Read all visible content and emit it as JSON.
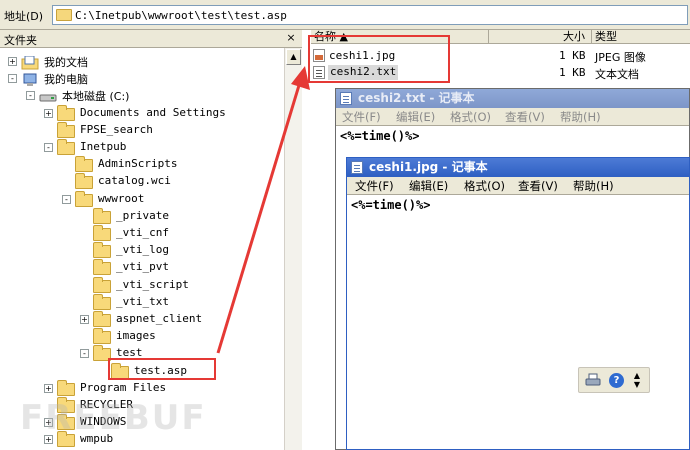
{
  "address_bar": {
    "label": "地址(D)",
    "path": "C:\\Inetpub\\wwwroot\\test\\test.asp"
  },
  "folders_pane": {
    "title": "文件夹",
    "close_glyph": "×",
    "tree": [
      {
        "label": "我的文档",
        "depth": 0,
        "toggle": "+",
        "icon": "my-documents-icon"
      },
      {
        "label": "我的电脑",
        "depth": 0,
        "toggle": "-",
        "icon": "my-computer-icon"
      },
      {
        "label": "本地磁盘 (C:)",
        "depth": 1,
        "toggle": "-",
        "icon": "local-disk-icon"
      },
      {
        "label": "Documents and Settings",
        "depth": 2,
        "toggle": "+",
        "icon": "folder-icon"
      },
      {
        "label": "FPSE_search",
        "depth": 2,
        "toggle": "",
        "icon": "folder-icon"
      },
      {
        "label": "Inetpub",
        "depth": 2,
        "toggle": "-",
        "icon": "folder-icon"
      },
      {
        "label": "AdminScripts",
        "depth": 3,
        "toggle": "",
        "icon": "folder-icon"
      },
      {
        "label": "catalog.wci",
        "depth": 3,
        "toggle": "",
        "icon": "folder-icon"
      },
      {
        "label": "wwwroot",
        "depth": 3,
        "toggle": "-",
        "icon": "folder-open-icon"
      },
      {
        "label": "_private",
        "depth": 4,
        "toggle": "",
        "icon": "folder-icon"
      },
      {
        "label": "_vti_cnf",
        "depth": 4,
        "toggle": "",
        "icon": "folder-icon"
      },
      {
        "label": "_vti_log",
        "depth": 4,
        "toggle": "",
        "icon": "folder-icon"
      },
      {
        "label": "_vti_pvt",
        "depth": 4,
        "toggle": "",
        "icon": "folder-icon"
      },
      {
        "label": "_vti_script",
        "depth": 4,
        "toggle": "",
        "icon": "folder-icon"
      },
      {
        "label": "_vti_txt",
        "depth": 4,
        "toggle": "",
        "icon": "folder-icon"
      },
      {
        "label": "aspnet_client",
        "depth": 4,
        "toggle": "+",
        "icon": "folder-icon"
      },
      {
        "label": "images",
        "depth": 4,
        "toggle": "",
        "icon": "folder-icon"
      },
      {
        "label": "test",
        "depth": 4,
        "toggle": "-",
        "icon": "folder-open-icon"
      },
      {
        "label": "test.asp",
        "depth": 5,
        "toggle": "",
        "icon": "folder-icon"
      },
      {
        "label": "Program Files",
        "depth": 2,
        "toggle": "+",
        "icon": "folder-icon"
      },
      {
        "label": "RECYCLER",
        "depth": 2,
        "toggle": "",
        "icon": "folder-icon"
      },
      {
        "label": "WINDOWS",
        "depth": 2,
        "toggle": "+",
        "icon": "folder-icon"
      },
      {
        "label": "wmpub",
        "depth": 2,
        "toggle": "+",
        "icon": "folder-icon"
      }
    ]
  },
  "file_list": {
    "columns": [
      "名称 ▲",
      "大小",
      "类型"
    ],
    "rows": [
      {
        "name": "ceshi1.jpg",
        "size": "1 KB",
        "type": "JPEG 图像",
        "icon": "jpeg-file-icon"
      },
      {
        "name": "ceshi2.txt",
        "size": "1 KB",
        "type": "文本文档",
        "icon": "text-file-icon"
      }
    ]
  },
  "notepad_back": {
    "title": "ceshi2.txt - 记事本",
    "menu": [
      "文件(F)",
      "编辑(E)",
      "格式(O)",
      "查看(V)",
      "帮助(H)"
    ],
    "content": "<%=time()%>"
  },
  "notepad_front": {
    "title": "ceshi1.jpg - 记事本",
    "menu": [
      "文件(F)",
      "编辑(E)",
      "格式(O)",
      "查看(V)",
      "帮助(H)"
    ],
    "content": "<%=time()%>"
  },
  "watermark": "FREEBUF",
  "colors": {
    "highlight": "#e53935",
    "title_active": "#2e5fc2",
    "chrome": "#ece9d8"
  }
}
